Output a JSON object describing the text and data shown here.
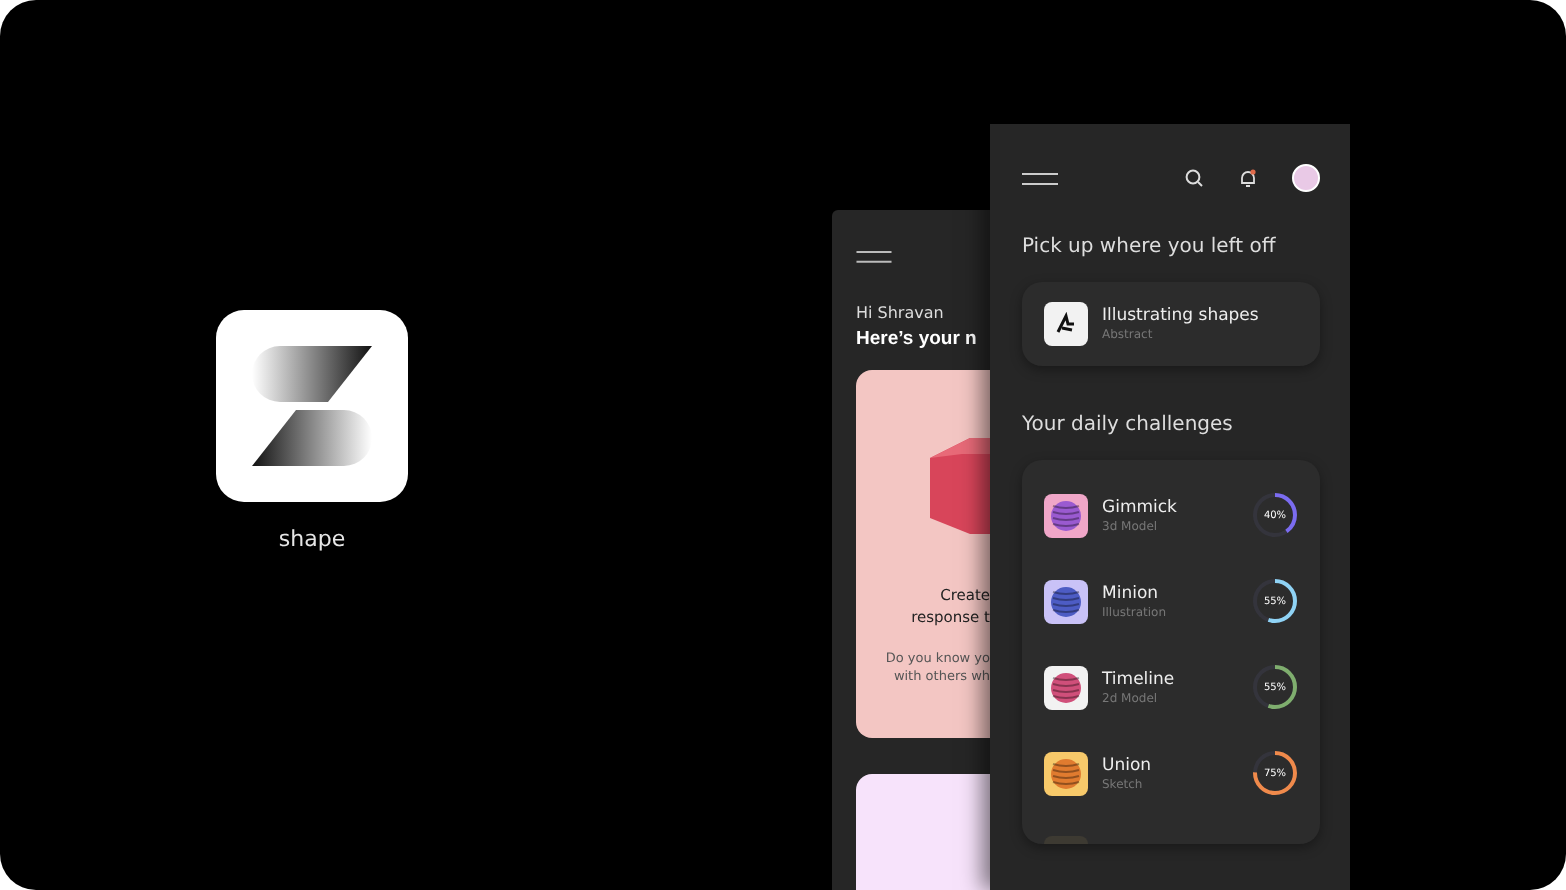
{
  "app": {
    "name": "shape"
  },
  "back_screen": {
    "greeting": "Hi Shravan",
    "heading": "Here’s your n",
    "card": {
      "title_lines": [
        "Create",
        "response t"
      ],
      "body_lines": [
        "Do you know yo",
        "with others wh"
      ]
    }
  },
  "front_screen": {
    "resume_heading": "Pick up where you left off",
    "resume_item": {
      "title": "Illustrating shapes",
      "subtitle": "Abstract"
    },
    "challenges_heading": "Your daily challenges",
    "challenges": [
      {
        "title": "Gimmick",
        "subtitle": "3d Model",
        "reading": "40%",
        "level": 0.4,
        "color": "#7b6cf0"
      },
      {
        "title": "Minion",
        "subtitle": "Illustration",
        "reading": "55%",
        "level": 0.55,
        "color": "#8fd3f5"
      },
      {
        "title": "Timeline",
        "subtitle": "2d Model",
        "reading": "55%",
        "level": 0.55,
        "color": "#7fae6e"
      },
      {
        "title": "Union",
        "subtitle": "Sketch",
        "reading": "75%",
        "level": 0.75,
        "color": "#f08a4b"
      }
    ]
  }
}
